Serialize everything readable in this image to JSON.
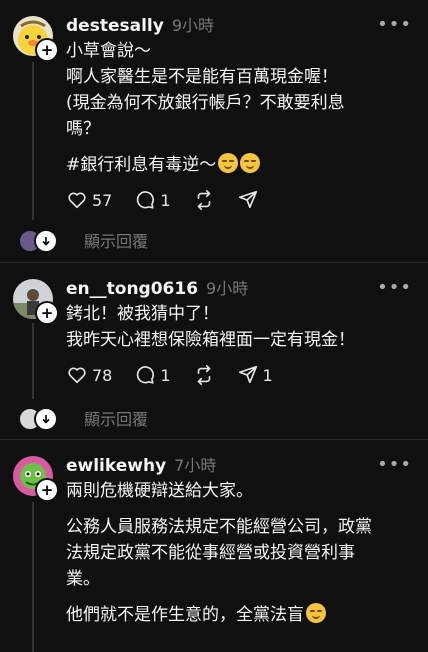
{
  "posts": [
    {
      "username": "destesally",
      "time": "9小時",
      "lines": [
        "小草會說～",
        "啊人家醫生是不是能有百萬現金喔！",
        "(現金為何不放銀行帳戶？不敢要利息",
        "嗎？"
      ],
      "hashtag_line": "#銀行利息有毒逆～",
      "likes": "57",
      "comments": "1",
      "reposts": "",
      "shares": "",
      "view_replies": "顯示回覆"
    },
    {
      "username": "en__tong0616",
      "time": "9小時",
      "lines": [
        "銬北！被我猜中了！",
        "我昨天心裡想保險箱裡面一定有現金！"
      ],
      "likes": "78",
      "comments": "1",
      "reposts": "",
      "shares": "1",
      "view_replies": "顯示回覆"
    },
    {
      "username": "ewlikewhy",
      "time": "7小時",
      "p1": "兩則危機硬辯送給大家。",
      "p2_lines": [
        "公務人員服務法規定不能經營公司，政黨",
        "法規定政黨不能從事經營或投資營利事",
        "業。"
      ],
      "p3": "他們就不是作生意的，全黨法盲"
    }
  ],
  "icons": {
    "more": "more-horizontal-icon",
    "like": "heart-icon",
    "comment": "comment-icon",
    "repost": "repost-icon",
    "share": "send-icon",
    "add": "plus-icon"
  }
}
